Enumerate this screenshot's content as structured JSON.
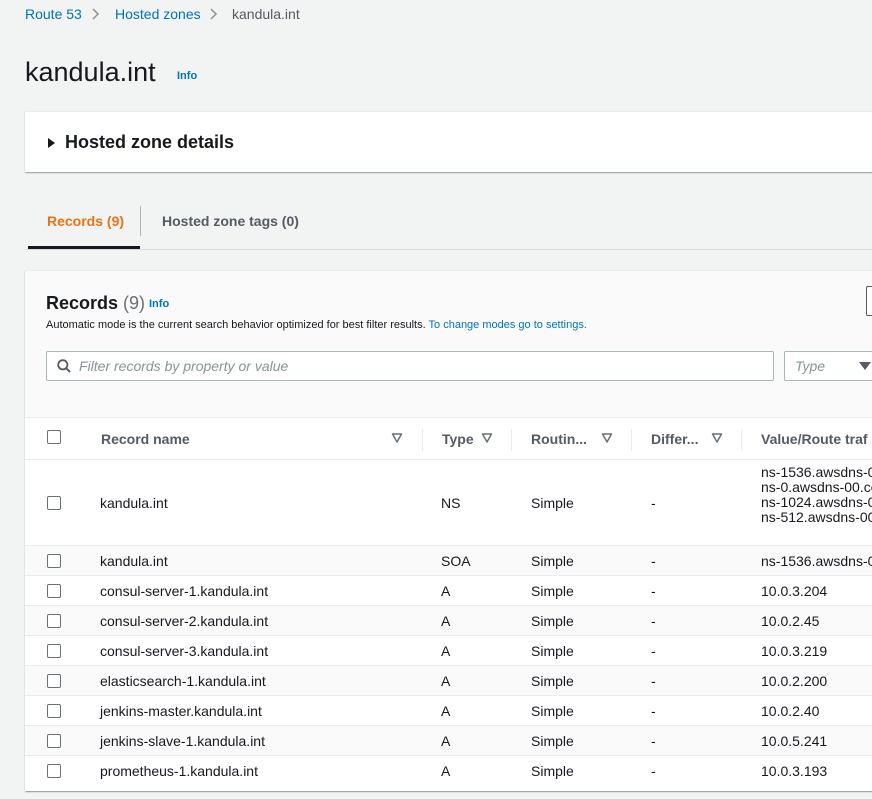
{
  "breadcrumb": {
    "items": [
      {
        "label": "Route 53"
      },
      {
        "label": "Hosted zones"
      }
    ],
    "current": "kandula.int"
  },
  "page": {
    "title": "kandula.int",
    "info_label": "Info"
  },
  "details_panel": {
    "title": "Hosted zone details",
    "expanded": false
  },
  "tabs": [
    {
      "label": "Records (9)",
      "active": true
    },
    {
      "label": "Hosted zone tags (0)",
      "active": false
    }
  ],
  "records": {
    "title": "Records",
    "count": "(9)",
    "info_label": "Info",
    "description": "Automatic mode is the current search behavior optimized for best filter results.",
    "description_link": "To change modes go to settings.",
    "search": {
      "placeholder": "Filter records by property or value",
      "value": ""
    },
    "type_filter": {
      "placeholder": "Type"
    },
    "columns": [
      "Record name",
      "Type",
      "Routin...",
      "Differ...",
      "Value/Route traf"
    ],
    "rows": [
      {
        "name": "kandula.int",
        "type": "NS",
        "routing": "Simple",
        "differ": "-",
        "values": [
          "ns-1536.awsdns-0",
          "ns-0.awsdns-00.co",
          "ns-1024.awsdns-0",
          "ns-512.awsdns-00"
        ]
      },
      {
        "name": "kandula.int",
        "type": "SOA",
        "routing": "Simple",
        "differ": "-",
        "value": "ns-1536.awsdns-0"
      },
      {
        "name": "consul-server-1.kandula.int",
        "type": "A",
        "routing": "Simple",
        "differ": "-",
        "value": "10.0.3.204"
      },
      {
        "name": "consul-server-2.kandula.int",
        "type": "A",
        "routing": "Simple",
        "differ": "-",
        "value": "10.0.2.45"
      },
      {
        "name": "consul-server-3.kandula.int",
        "type": "A",
        "routing": "Simple",
        "differ": "-",
        "value": "10.0.3.219"
      },
      {
        "name": "elasticsearch-1.kandula.int",
        "type": "A",
        "routing": "Simple",
        "differ": "-",
        "value": "10.0.2.200"
      },
      {
        "name": "jenkins-master.kandula.int",
        "type": "A",
        "routing": "Simple",
        "differ": "-",
        "value": "10.0.2.40"
      },
      {
        "name": "jenkins-slave-1.kandula.int",
        "type": "A",
        "routing": "Simple",
        "differ": "-",
        "value": "10.0.5.241"
      },
      {
        "name": "prometheus-1.kandula.int",
        "type": "A",
        "routing": "Simple",
        "differ": "-",
        "value": "10.0.3.193"
      }
    ]
  },
  "colors": {
    "link": "#0073bb",
    "active_tab": "#ec7211",
    "background": "#f2f3f3"
  },
  "icons": {
    "breadcrumb_separator": "chevron-right-icon",
    "search": "search-icon",
    "sort": "sort-caret-down-icon",
    "expand": "caret-right-icon"
  }
}
